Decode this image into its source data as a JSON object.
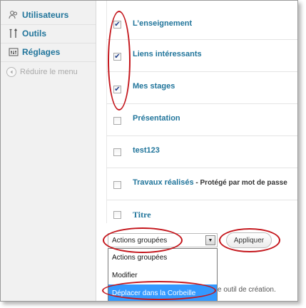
{
  "sidebar": {
    "items": [
      {
        "label": "Utilisateurs",
        "icon": "users-icon"
      },
      {
        "label": "Outils",
        "icon": "tools-icon"
      },
      {
        "label": "Réglages",
        "icon": "settings-icon"
      }
    ],
    "collapse_label": "Réduire le menu"
  },
  "posts": [
    {
      "title": "L’enseignement",
      "checked": true
    },
    {
      "title": "Liens intéressants",
      "checked": true
    },
    {
      "title": "Mes stages",
      "checked": true
    },
    {
      "title": "Présentation",
      "checked": false
    },
    {
      "title": "test123",
      "checked": false
    },
    {
      "title": "Travaux réalisés",
      "note": " - Protégé par mot de passe",
      "checked": false
    },
    {
      "title": "Titre",
      "checked": false
    }
  ],
  "bulk_actions": {
    "selected": "Actions groupées",
    "options": [
      "Actions groupées",
      "Modifier",
      "Déplacer dans la Corbeille"
    ],
    "highlighted": "Déplacer dans la Corbeille"
  },
  "apply_label": "Appliquer",
  "footer_text": "e outil de création.",
  "colors": {
    "link": "#21759b",
    "highlight_ring": "#c4161c",
    "selected_option": "#3399ff",
    "sidebar_bg": "#f1f1f1"
  }
}
